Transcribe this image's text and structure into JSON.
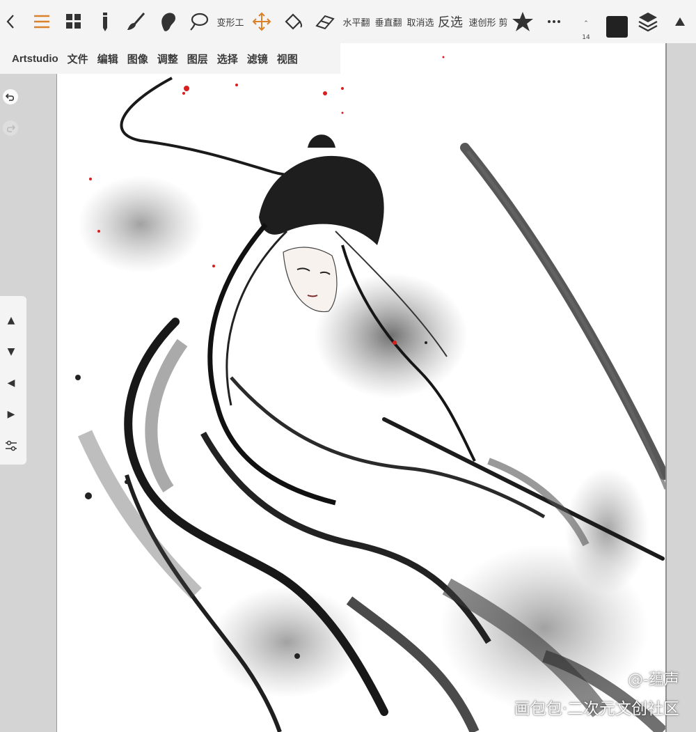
{
  "toolbar": {
    "back_icon": "chevron-left-icon",
    "menu_icon": "hamburger-icon",
    "grid_icon": "grid-icon",
    "pencil_icon": "pencil-icon",
    "brush_icon": "brush-icon",
    "smudge_icon": "smudge-icon",
    "lasso_icon": "lasso-icon",
    "transform_label": "变形工",
    "move_icon": "move-arrows-icon",
    "fill_icon": "fill-bucket-icon",
    "eraser_icon": "eraser-icon",
    "flip_h_label": "水平翻",
    "flip_v_label": "垂直翻",
    "deselect_label": "取消选",
    "invert_label": "反选",
    "quick_shape_label": "速创形",
    "cut_label": "剪",
    "star_icon": "star-icon",
    "more_icon": "more-dots-icon",
    "brush_size": "14",
    "color_hex": "#222222",
    "layers_icon": "layers-icon",
    "collapse_icon": "triangle-up-icon",
    "accent_color": "#d9822b"
  },
  "menubar": {
    "items": [
      "Artstudio",
      "文件",
      "编辑",
      "图像",
      "调整",
      "图层",
      "选择",
      "滤镜",
      "视图"
    ]
  },
  "history": {
    "undo_icon": "undo-icon",
    "redo_icon": "redo-icon"
  },
  "side_panel": {
    "buttons": [
      "▲",
      "▼",
      "◀",
      "▶"
    ],
    "settings_icon": "sliders-icon"
  },
  "canvas": {
    "artwork": "ink-painting-artwork"
  },
  "watermark": {
    "handle": "@-蕴声",
    "site": "画包包·二次元文创社区"
  }
}
